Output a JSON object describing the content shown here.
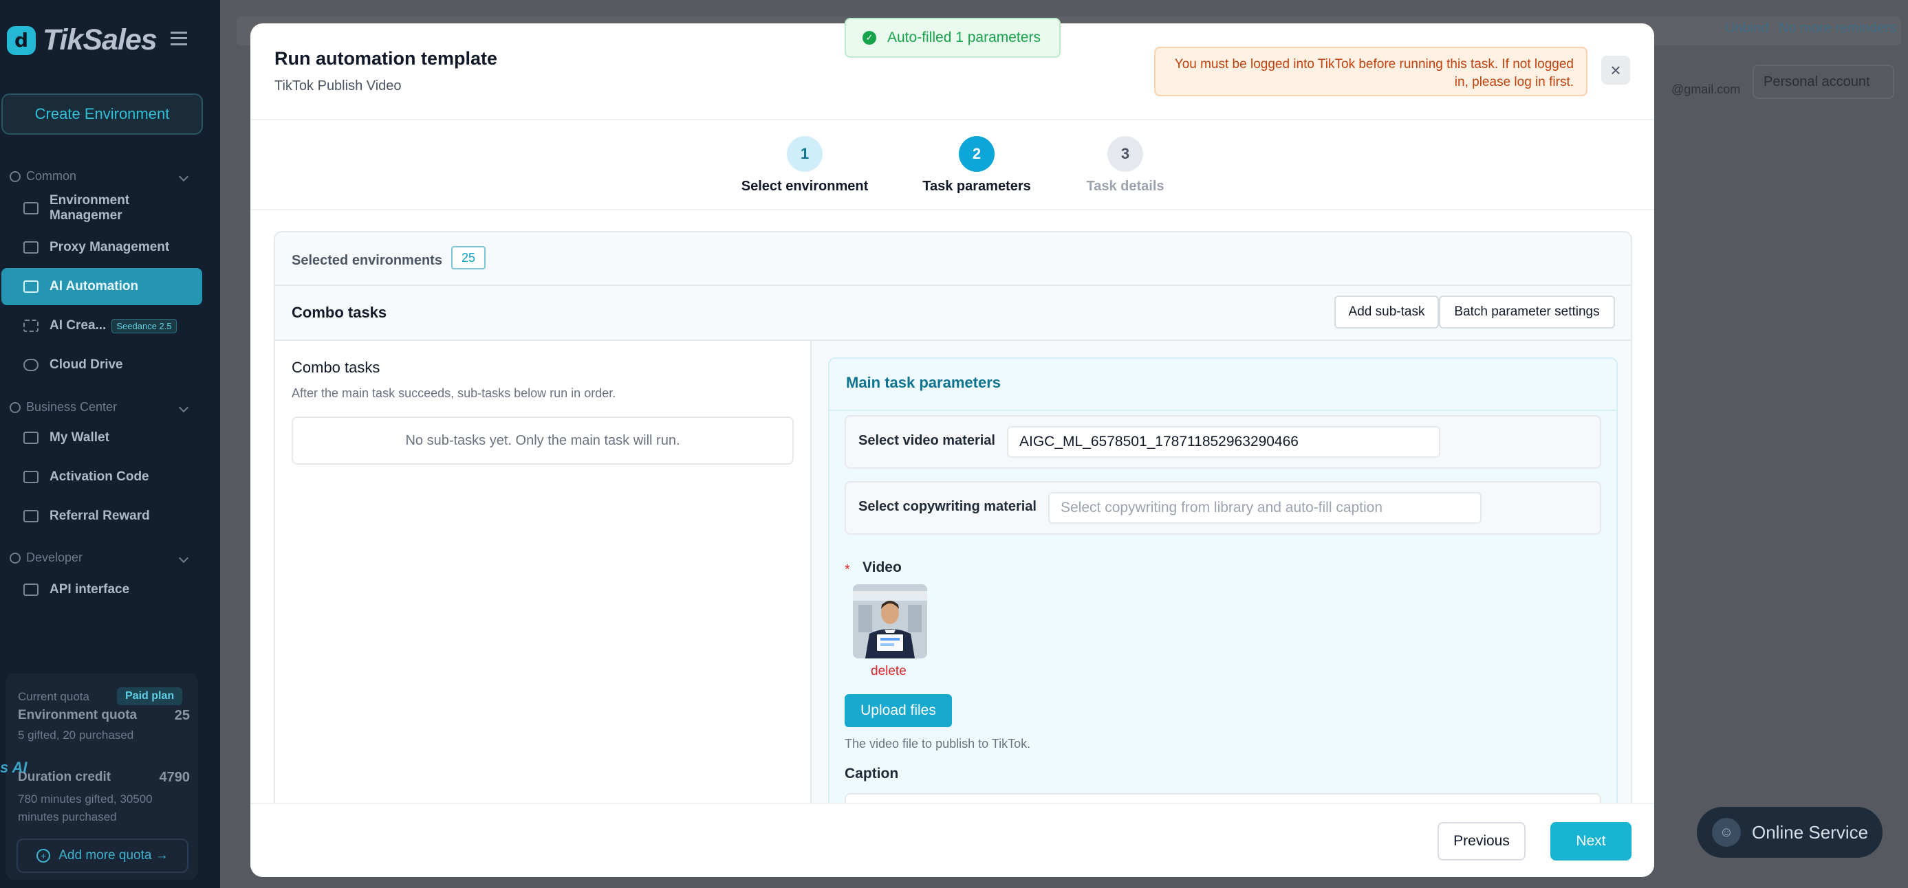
{
  "sidebar": {
    "logo_text": "TikSales",
    "create_env": "Create Environment",
    "sections": {
      "common": "Common",
      "business": "Business Center",
      "developer": "Developer"
    },
    "items": {
      "env_mgmt": "Environment Managemer",
      "proxy": "Proxy Management",
      "ai_auto": "AI Automation",
      "ai_crea": "AI Crea...",
      "seedance": "Seedance 2.5",
      "cloud": "Cloud Drive",
      "wallet": "My Wallet",
      "activation": "Activation Code",
      "referral": "Referral Reward",
      "api": "API interface"
    },
    "quota": {
      "current": "Current quota",
      "paid": "Paid plan",
      "env_quota_label": "Environment quota",
      "env_quota_value": "25",
      "env_quota_detail": "5 gifted, 20 purchased",
      "credit_label": "Duration credit",
      "credit_value": "4790",
      "credit_detail": "780 minutes gifted, 30500 minutes purchased",
      "add_more": "Add more quota →"
    },
    "ai_badge": "s AI"
  },
  "background": {
    "unbind": "Unbind",
    "no_more": "No more reminders",
    "email": "@gmail.com",
    "account": "Personal account"
  },
  "modal": {
    "title": "Run automation template",
    "subtitle": "TikTok Publish Video",
    "warning": "You must be logged into TikTok before running this task. If not logged in, please log in first.",
    "close": "×",
    "steps": [
      {
        "num": "1",
        "label": "Select environment"
      },
      {
        "num": "2",
        "label": "Task parameters"
      },
      {
        "num": "3",
        "label": "Task details"
      }
    ],
    "selected_env_label": "Selected environments",
    "selected_env_count": "25",
    "combo_title": "Combo tasks",
    "add_subtask": "Add sub-task",
    "batch_settings": "Batch parameter settings",
    "left": {
      "title": "Combo tasks",
      "desc": "After the main task succeeds, sub-tasks below run in order.",
      "empty": "No sub-tasks yet. Only the main task will run."
    },
    "main_params": {
      "title": "Main task parameters",
      "video_material_label": "Select video material",
      "video_material_value": "AIGC_ML_6578501_178711852963290466",
      "copy_material_label": "Select copywriting material",
      "copy_material_placeholder": "Select copywriting from library and auto-fill caption",
      "required_mark": "*",
      "video_label": "Video",
      "delete": "delete",
      "upload": "Upload files",
      "upload_hint": "The video file to publish to TikTok.",
      "caption_label": "Caption"
    },
    "prev": "Previous",
    "next": "Next"
  },
  "toast": "Auto-filled 1 parameters",
  "online_service": "Online Service",
  "colors": {
    "accent": "#19b3d3",
    "sidebar_bg": "#131f2e",
    "warning": "#c2410c",
    "success": "#16a34a"
  }
}
